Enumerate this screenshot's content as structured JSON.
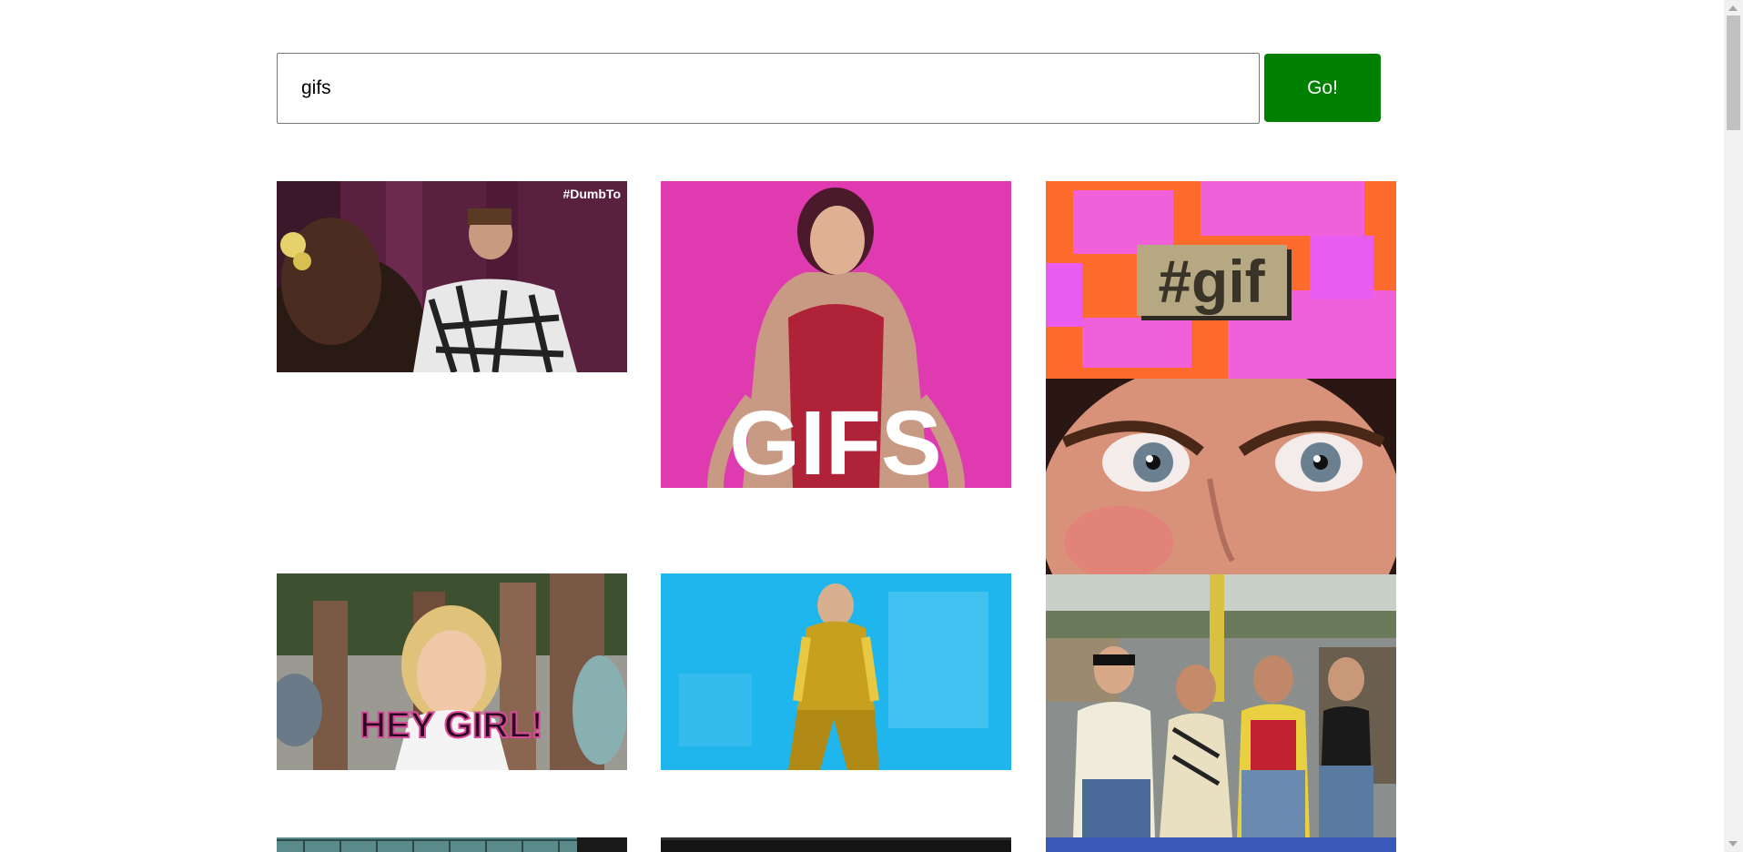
{
  "search": {
    "value": "gifs",
    "button_label": "Go!"
  },
  "gifs": [
    {
      "caption": "#DumbTo"
    },
    {
      "caption": "GIFS"
    },
    {
      "caption": "#gif"
    },
    {
      "caption": ""
    },
    {
      "caption": "HEY GIRL!"
    },
    {
      "caption": ""
    },
    {
      "caption": ""
    }
  ],
  "colors": {
    "go_button": "#008000",
    "gif_pink": "#e03ab0",
    "gif_blue": "#1fb6ee",
    "gif_orange": "#fc6a2c"
  }
}
